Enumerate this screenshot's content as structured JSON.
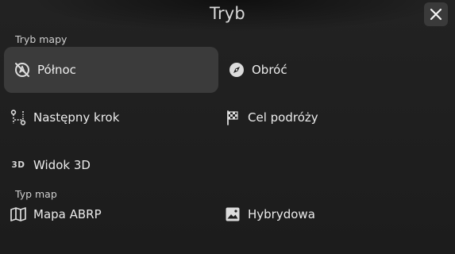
{
  "header": {
    "title": "Tryb",
    "close_icon": "close-icon"
  },
  "sections": {
    "map_mode": {
      "label": "Tryb mapy",
      "items": [
        {
          "label": "Północ",
          "icon": "north-up-icon",
          "selected": true
        },
        {
          "label": "Obróć",
          "icon": "compass-icon",
          "selected": false
        },
        {
          "label": "Następny krok",
          "icon": "route-steps-icon",
          "selected": false
        },
        {
          "label": "Cel podróży",
          "icon": "checkered-flag-icon",
          "selected": false
        },
        {
          "label": "Widok 3D",
          "icon": "3d-icon",
          "icon_text": "3D",
          "selected": false
        }
      ]
    },
    "map_type": {
      "label": "Typ map",
      "items": [
        {
          "label": "Mapa ABRP",
          "icon": "map-icon",
          "selected": false
        },
        {
          "label": "Hybrydowa",
          "icon": "image-icon",
          "selected": false
        }
      ]
    }
  },
  "colors": {
    "background": "#1e1e1e",
    "selected_bg": "#3b3b3b",
    "text": "#ececec",
    "close_bg": "#3a3a3a"
  }
}
